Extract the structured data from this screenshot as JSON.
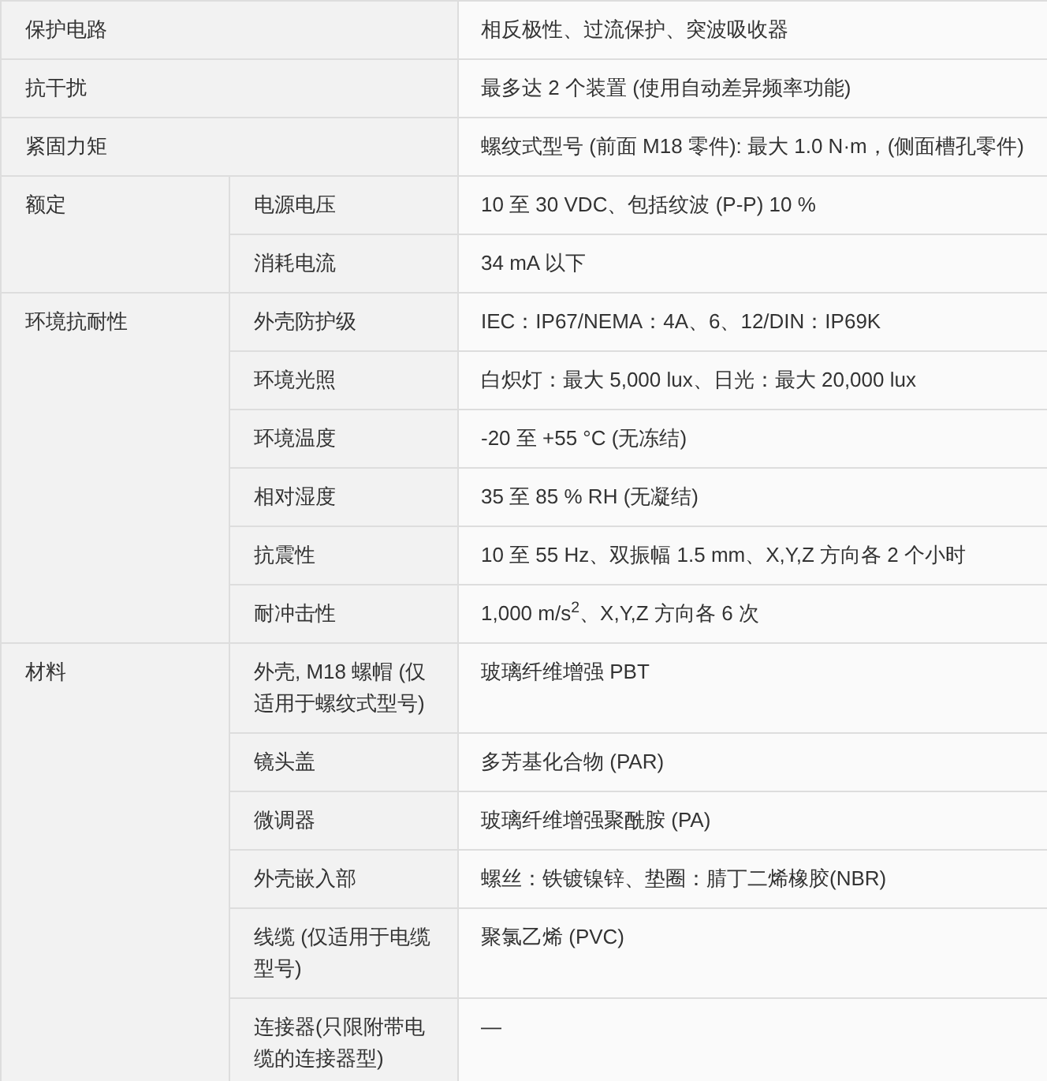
{
  "spec_table": {
    "rows": [
      {
        "kind": "single",
        "label": "保护电路",
        "value": "相反极性、过流保护、突波吸收器"
      },
      {
        "kind": "single",
        "label": "抗干扰",
        "value": "最多达 2 个装置 (使用自动差异频率功能)"
      },
      {
        "kind": "single",
        "label": "紧固力矩",
        "value": "螺纹式型号 (前面 M18 零件): 最大 1.0 N·m，(侧面槽孔零件)"
      },
      {
        "kind": "group",
        "label": "额定",
        "items": [
          {
            "label": "电源电压",
            "value": "10 至 30 VDC、包括纹波 (P-P) 10 %"
          },
          {
            "label": "消耗电流",
            "value": "34 mA 以下"
          }
        ]
      },
      {
        "kind": "group",
        "label": "环境抗耐性",
        "items": [
          {
            "label": "外壳防护级",
            "value": "IEC：IP67/NEMA：4A、6、12/DIN：IP69K"
          },
          {
            "label": "环境光照",
            "value": "白炽灯：最大 5,000 lux、日光：最大 20,000 lux"
          },
          {
            "label": "环境温度",
            "value": "-20 至 +55 °C (无冻结)"
          },
          {
            "label": "相对湿度",
            "value": "35 至 85 % RH (无凝结)"
          },
          {
            "label": "抗震性",
            "value": "10 至 55 Hz、双振幅 1.5 mm、X,Y,Z 方向各 2 个小时"
          },
          {
            "label": "耐冲击性",
            "value": "1,000 m/s$^{2}$、X,Y,Z 方向各 6 次"
          }
        ]
      },
      {
        "kind": "group",
        "label": "材料",
        "items": [
          {
            "label": "外壳, M18 螺帽 (仅适用于螺纹式型号)",
            "value": "玻璃纤维增强 PBT"
          },
          {
            "label": "镜头盖",
            "value": "多芳基化合物 (PAR)"
          },
          {
            "label": "微调器",
            "value": "玻璃纤维增强聚酰胺 (PA)"
          },
          {
            "label": "外壳嵌入部",
            "value": "螺丝：铁镀镍锌、垫圈：腈丁二烯橡胶(NBR)"
          },
          {
            "label": "线缆 (仅适用于电缆型号)",
            "value": "聚氯乙烯 (PVC)"
          },
          {
            "label": "连接器(只限附带电缆的连接器型)",
            "value": "—"
          }
        ]
      }
    ]
  }
}
